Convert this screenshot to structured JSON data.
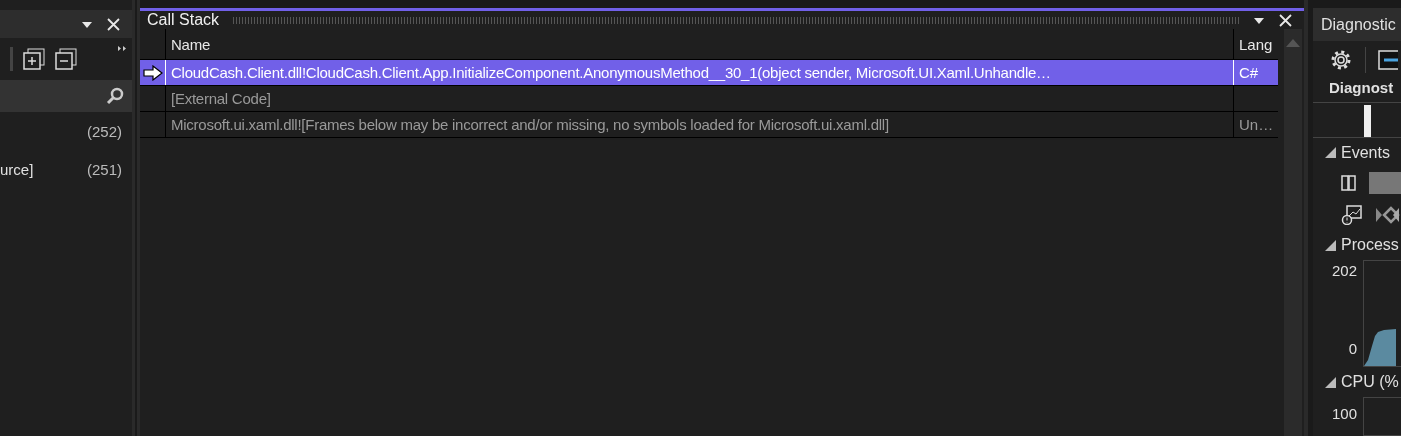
{
  "left_panel": {
    "rows": [
      {
        "label": "",
        "count": "(252)"
      },
      {
        "label": "urce]",
        "count": "(251)"
      }
    ]
  },
  "call_stack": {
    "title": "Call Stack",
    "columns": [
      "Name",
      "Lang"
    ],
    "rows": [
      {
        "name": "CloudCash.Client.dll!CloudCash.Client.App.InitializeComponent.AnonymousMethod__30_1(object sender, Microsoft.UI.Xaml.Unhandle…",
        "language": "C#",
        "selected": true,
        "current": true
      },
      {
        "name": "[External Code]",
        "language": "",
        "selected": false,
        "current": false
      },
      {
        "name": "Microsoft.ui.xaml.dll![Frames below may be incorrect and/or missing, no symbols loaded for Microsoft.ui.xaml.dll]",
        "language": "Un…",
        "selected": false,
        "current": false
      }
    ]
  },
  "diagnostics": {
    "title": "Diagnostic",
    "tab": "Diagnost",
    "sections": [
      {
        "title": "Events",
        "kind": "events"
      },
      {
        "title": "Process",
        "kind": "chart",
        "y_max": "202",
        "y_min": "0"
      },
      {
        "title": "CPU (%",
        "kind": "cpu",
        "y_max": "100"
      }
    ]
  }
}
